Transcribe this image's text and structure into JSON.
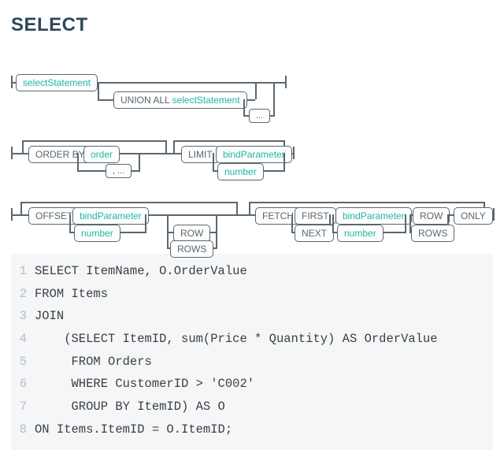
{
  "heading": "SELECT",
  "diagram": {
    "row1": {
      "selectStatement": "selectStatement",
      "union": {
        "kw": "UNION ALL ",
        "nt": "selectStatement"
      },
      "loopDots": "..."
    },
    "row2": {
      "orderBy": "ORDER BY",
      "order": "order",
      "loopDots": ", ...",
      "limit": "LIMIT",
      "bindParameter": "bindParameter",
      "number": "number"
    },
    "row3": {
      "offset": "OFFSET",
      "bindParameter": "bindParameter",
      "number": "number",
      "row": "ROW",
      "rows": "ROWS",
      "fetch": "FETCH",
      "first": "FIRST",
      "next": "NEXT",
      "bindParameter2": "bindParameter",
      "number2": "number",
      "row2": "ROW",
      "rows2": "ROWS",
      "only": "ONLY"
    }
  },
  "code": [
    {
      "n": "1",
      "text": "SELECT ItemName, O.OrderValue"
    },
    {
      "n": "2",
      "text": "FROM Items"
    },
    {
      "n": "3",
      "text": "JOIN"
    },
    {
      "n": "4",
      "text": "    (SELECT ItemID, sum(Price * Quantity) AS OrderValue"
    },
    {
      "n": "5",
      "text": "     FROM Orders"
    },
    {
      "n": "6",
      "text": "     WHERE CustomerID > 'C002'"
    },
    {
      "n": "7",
      "text": "     GROUP BY ItemID) AS O"
    },
    {
      "n": "8",
      "text": "ON Items.ItemID = O.ItemID;"
    }
  ]
}
